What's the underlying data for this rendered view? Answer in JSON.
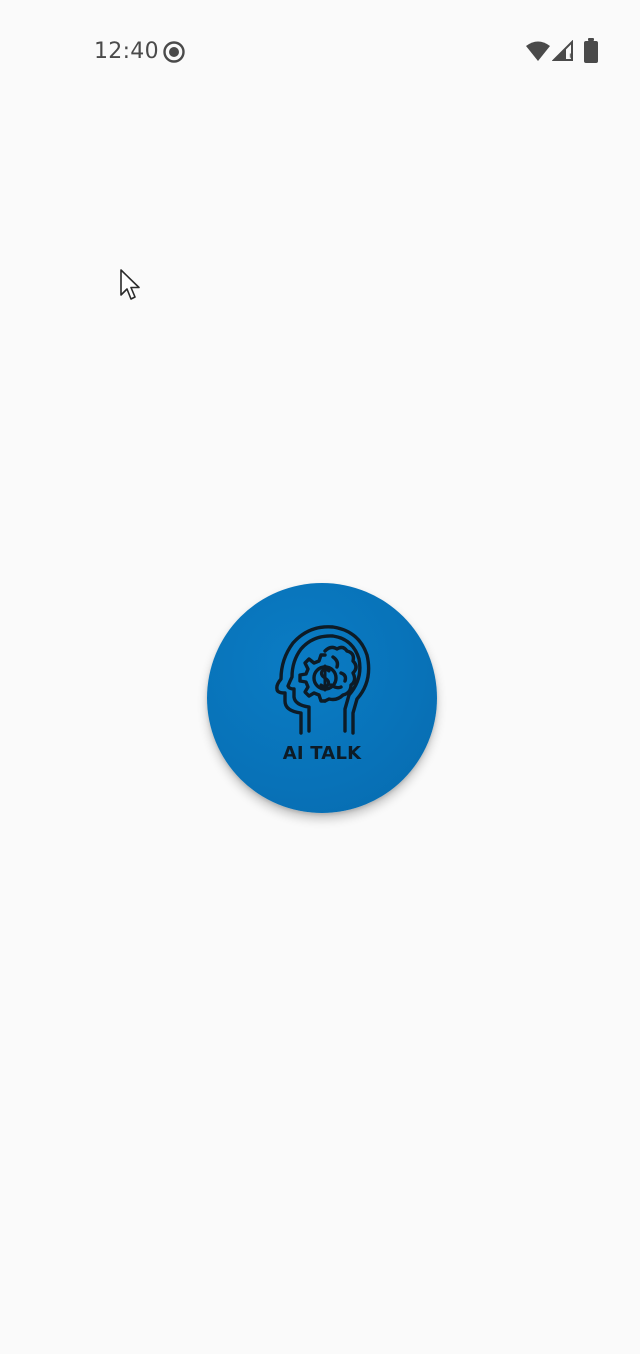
{
  "status_bar": {
    "time": "12:40",
    "icons": [
      "screen-record-icon",
      "wifi-icon",
      "cellular-signal-icon",
      "battery-icon"
    ]
  },
  "splash": {
    "logo_text": "AI TALK",
    "icon": "head-gear-brain-icon",
    "background_color": "#0872b8",
    "text_color": "#0d1b26"
  },
  "pointer": {
    "icon": "mouse-cursor-icon"
  }
}
